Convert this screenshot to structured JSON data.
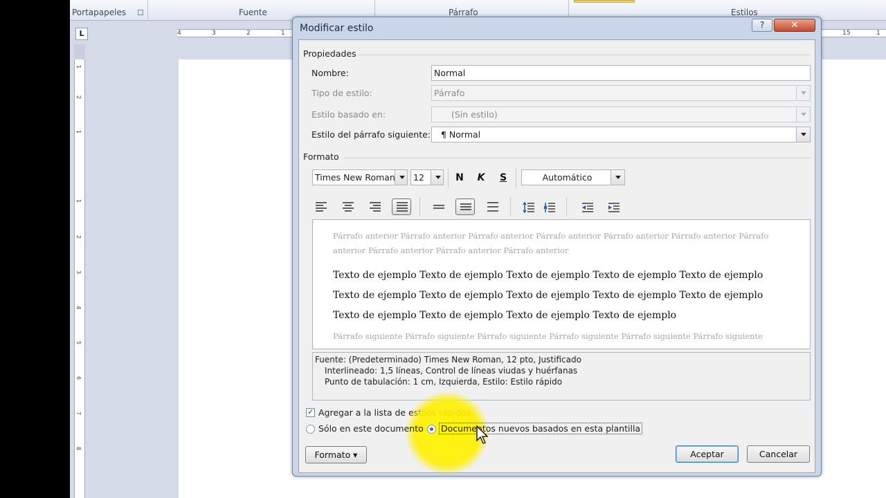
{
  "ribbon": {
    "groups": [
      "Portapapeles",
      "Fuente",
      "Párrafo",
      "Estilos"
    ]
  },
  "ruler": {
    "corner": "L",
    "h_ticks": [
      "4",
      "3",
      "2",
      "1",
      "15",
      "1"
    ],
    "v_ticks": [
      "1",
      "2",
      "1",
      "1",
      "2",
      "3",
      "4",
      "5",
      "6",
      "7",
      "8"
    ]
  },
  "dialog": {
    "title": "Modificar estilo",
    "help": "?",
    "close": "✕",
    "properties": {
      "heading": "Propiedades",
      "name_label": "Nombre:",
      "name_value": "Normal",
      "type_label": "Tipo de estilo:",
      "type_value": "Párrafo",
      "based_label": "Estilo basado en:",
      "based_value": "(Sin estilo)",
      "next_label": "Estilo del párrafo siguiente:",
      "next_value": "¶ Normal"
    },
    "format": {
      "heading": "Formato",
      "font": "Times New Roman",
      "size": "12",
      "bold": "N",
      "italic": "K",
      "underline": "S",
      "color": "Automático"
    },
    "preview": {
      "previous": "Párrafo anterior Párrafo anterior Párrafo anterior Párrafo anterior Párrafo anterior Párrafo anterior Párrafo anterior Párrafo anterior Párrafo anterior Párrafo anterior",
      "sample_lines": [
        "Texto de ejemplo Texto de ejemplo Texto de ejemplo Texto de ejemplo Texto de ejemplo",
        "Texto de ejemplo Texto de ejemplo Texto de ejemplo Texto de ejemplo Texto de ejemplo",
        "Texto de ejemplo Texto de ejemplo Texto de ejemplo Texto de ejemplo"
      ],
      "following": "Párrafo siguiente Párrafo siguiente Párrafo siguiente Párrafo siguiente Párrafo siguiente Párrafo siguiente"
    },
    "description": {
      "line1": "Fuente: (Predeterminado) Times New Roman, 12 pto, Justificado",
      "line2": "Interlineado:  1,5 líneas, Control de líneas viudas y huérfanas",
      "line3": "Punto de tabulación:  1 cm, Izquierda, Estilo: Estilo rápido"
    },
    "options": {
      "add_quick_styles": "Agregar a la lista de estilos rápidos",
      "add_quick_styles_checked": true,
      "only_this_doc": "Sólo en este documento",
      "new_docs_template": "Documentos nuevos basados en esta plantilla",
      "selected_option": "new_docs_template"
    },
    "buttons": {
      "format": "Formato ▾",
      "accept": "Aceptar",
      "cancel": "Cancelar"
    }
  },
  "colors": {
    "dialog_frame": "#c9d6e8",
    "close_red": "#c74b2f",
    "highlight_yellow": "#fff000"
  }
}
